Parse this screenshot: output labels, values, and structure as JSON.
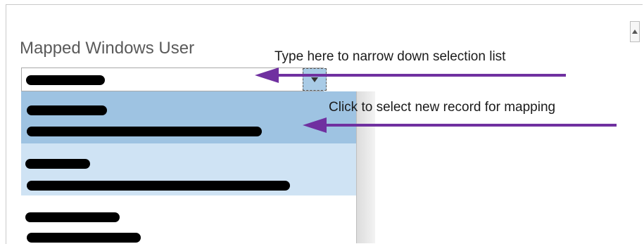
{
  "field": {
    "label": "Mapped Windows User",
    "dropdown_icon": "triangle-down-icon"
  },
  "annotations": {
    "narrow_down": "Type here to narrow down selection list",
    "select_record": "Click to select new record for mapping",
    "arrow_color": "#7030a0"
  },
  "dropdown_list": {
    "items": [
      {
        "state": "selected",
        "primary_text": "[redacted]",
        "secondary_text": "[redacted]"
      },
      {
        "state": "hover",
        "primary_text": "[redacted]",
        "secondary_text": "[redacted]"
      },
      {
        "state": "normal",
        "primary_text": "[redacted]",
        "secondary_text": "[redacted]"
      }
    ]
  },
  "colors": {
    "selected_row": "#9ec3e2",
    "hover_row": "#cfe3f4",
    "dropdown_button": "#a9cbe6"
  }
}
